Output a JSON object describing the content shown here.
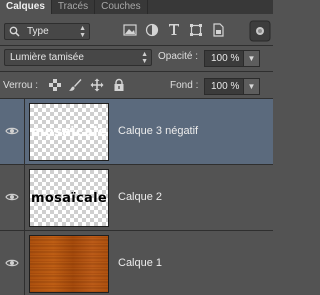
{
  "tabs": [
    {
      "label": "Calques",
      "active": true
    },
    {
      "label": "Tracés",
      "active": false
    },
    {
      "label": "Couches",
      "active": false
    }
  ],
  "filter": {
    "kind_label": "Type",
    "icons": [
      "image-filter-icon",
      "adjustment-filter-icon",
      "type-filter-icon",
      "shape-filter-icon",
      "smart-object-filter-icon"
    ]
  },
  "blend": {
    "mode": "Lumière tamisée",
    "opacity_label": "Opacité :",
    "opacity_value": "100 %"
  },
  "lock": {
    "label": "Verrou :",
    "fill_label": "Fond :",
    "fill_value": "100 %"
  },
  "layers": [
    {
      "name": "Calque 3 négatif",
      "thumb_text": "mosaïcale",
      "selected": true,
      "visible": true
    },
    {
      "name": "Calque 2",
      "thumb_text": "mosaïcale",
      "selected": false,
      "visible": true
    },
    {
      "name": "Calque 1",
      "thumb_text": "",
      "selected": false,
      "visible": true
    }
  ],
  "colors": {
    "panel": "#535353",
    "selected_row": "#5b6a7d",
    "wood": "#b1540f"
  }
}
